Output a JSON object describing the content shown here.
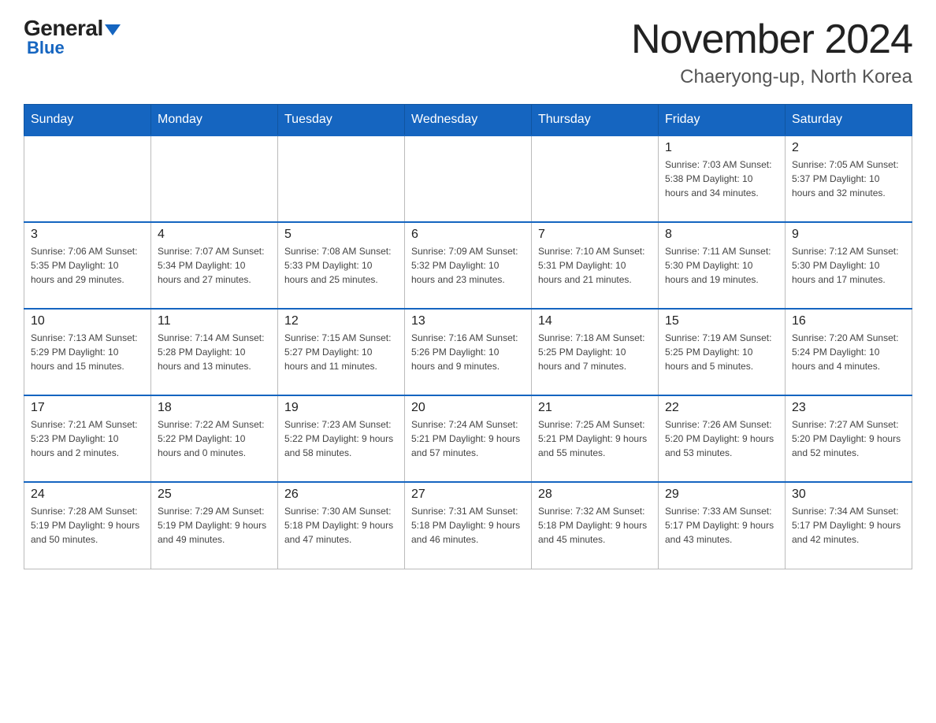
{
  "logo": {
    "general": "General",
    "blue": "Blue"
  },
  "header": {
    "month": "November 2024",
    "location": "Chaeryong-up, North Korea"
  },
  "days_of_week": [
    "Sunday",
    "Monday",
    "Tuesday",
    "Wednesday",
    "Thursday",
    "Friday",
    "Saturday"
  ],
  "weeks": [
    [
      {
        "day": "",
        "info": ""
      },
      {
        "day": "",
        "info": ""
      },
      {
        "day": "",
        "info": ""
      },
      {
        "day": "",
        "info": ""
      },
      {
        "day": "",
        "info": ""
      },
      {
        "day": "1",
        "info": "Sunrise: 7:03 AM\nSunset: 5:38 PM\nDaylight: 10 hours and 34 minutes."
      },
      {
        "day": "2",
        "info": "Sunrise: 7:05 AM\nSunset: 5:37 PM\nDaylight: 10 hours and 32 minutes."
      }
    ],
    [
      {
        "day": "3",
        "info": "Sunrise: 7:06 AM\nSunset: 5:35 PM\nDaylight: 10 hours and 29 minutes."
      },
      {
        "day": "4",
        "info": "Sunrise: 7:07 AM\nSunset: 5:34 PM\nDaylight: 10 hours and 27 minutes."
      },
      {
        "day": "5",
        "info": "Sunrise: 7:08 AM\nSunset: 5:33 PM\nDaylight: 10 hours and 25 minutes."
      },
      {
        "day": "6",
        "info": "Sunrise: 7:09 AM\nSunset: 5:32 PM\nDaylight: 10 hours and 23 minutes."
      },
      {
        "day": "7",
        "info": "Sunrise: 7:10 AM\nSunset: 5:31 PM\nDaylight: 10 hours and 21 minutes."
      },
      {
        "day": "8",
        "info": "Sunrise: 7:11 AM\nSunset: 5:30 PM\nDaylight: 10 hours and 19 minutes."
      },
      {
        "day": "9",
        "info": "Sunrise: 7:12 AM\nSunset: 5:30 PM\nDaylight: 10 hours and 17 minutes."
      }
    ],
    [
      {
        "day": "10",
        "info": "Sunrise: 7:13 AM\nSunset: 5:29 PM\nDaylight: 10 hours and 15 minutes."
      },
      {
        "day": "11",
        "info": "Sunrise: 7:14 AM\nSunset: 5:28 PM\nDaylight: 10 hours and 13 minutes."
      },
      {
        "day": "12",
        "info": "Sunrise: 7:15 AM\nSunset: 5:27 PM\nDaylight: 10 hours and 11 minutes."
      },
      {
        "day": "13",
        "info": "Sunrise: 7:16 AM\nSunset: 5:26 PM\nDaylight: 10 hours and 9 minutes."
      },
      {
        "day": "14",
        "info": "Sunrise: 7:18 AM\nSunset: 5:25 PM\nDaylight: 10 hours and 7 minutes."
      },
      {
        "day": "15",
        "info": "Sunrise: 7:19 AM\nSunset: 5:25 PM\nDaylight: 10 hours and 5 minutes."
      },
      {
        "day": "16",
        "info": "Sunrise: 7:20 AM\nSunset: 5:24 PM\nDaylight: 10 hours and 4 minutes."
      }
    ],
    [
      {
        "day": "17",
        "info": "Sunrise: 7:21 AM\nSunset: 5:23 PM\nDaylight: 10 hours and 2 minutes."
      },
      {
        "day": "18",
        "info": "Sunrise: 7:22 AM\nSunset: 5:22 PM\nDaylight: 10 hours and 0 minutes."
      },
      {
        "day": "19",
        "info": "Sunrise: 7:23 AM\nSunset: 5:22 PM\nDaylight: 9 hours and 58 minutes."
      },
      {
        "day": "20",
        "info": "Sunrise: 7:24 AM\nSunset: 5:21 PM\nDaylight: 9 hours and 57 minutes."
      },
      {
        "day": "21",
        "info": "Sunrise: 7:25 AM\nSunset: 5:21 PM\nDaylight: 9 hours and 55 minutes."
      },
      {
        "day": "22",
        "info": "Sunrise: 7:26 AM\nSunset: 5:20 PM\nDaylight: 9 hours and 53 minutes."
      },
      {
        "day": "23",
        "info": "Sunrise: 7:27 AM\nSunset: 5:20 PM\nDaylight: 9 hours and 52 minutes."
      }
    ],
    [
      {
        "day": "24",
        "info": "Sunrise: 7:28 AM\nSunset: 5:19 PM\nDaylight: 9 hours and 50 minutes."
      },
      {
        "day": "25",
        "info": "Sunrise: 7:29 AM\nSunset: 5:19 PM\nDaylight: 9 hours and 49 minutes."
      },
      {
        "day": "26",
        "info": "Sunrise: 7:30 AM\nSunset: 5:18 PM\nDaylight: 9 hours and 47 minutes."
      },
      {
        "day": "27",
        "info": "Sunrise: 7:31 AM\nSunset: 5:18 PM\nDaylight: 9 hours and 46 minutes."
      },
      {
        "day": "28",
        "info": "Sunrise: 7:32 AM\nSunset: 5:18 PM\nDaylight: 9 hours and 45 minutes."
      },
      {
        "day": "29",
        "info": "Sunrise: 7:33 AM\nSunset: 5:17 PM\nDaylight: 9 hours and 43 minutes."
      },
      {
        "day": "30",
        "info": "Sunrise: 7:34 AM\nSunset: 5:17 PM\nDaylight: 9 hours and 42 minutes."
      }
    ]
  ]
}
